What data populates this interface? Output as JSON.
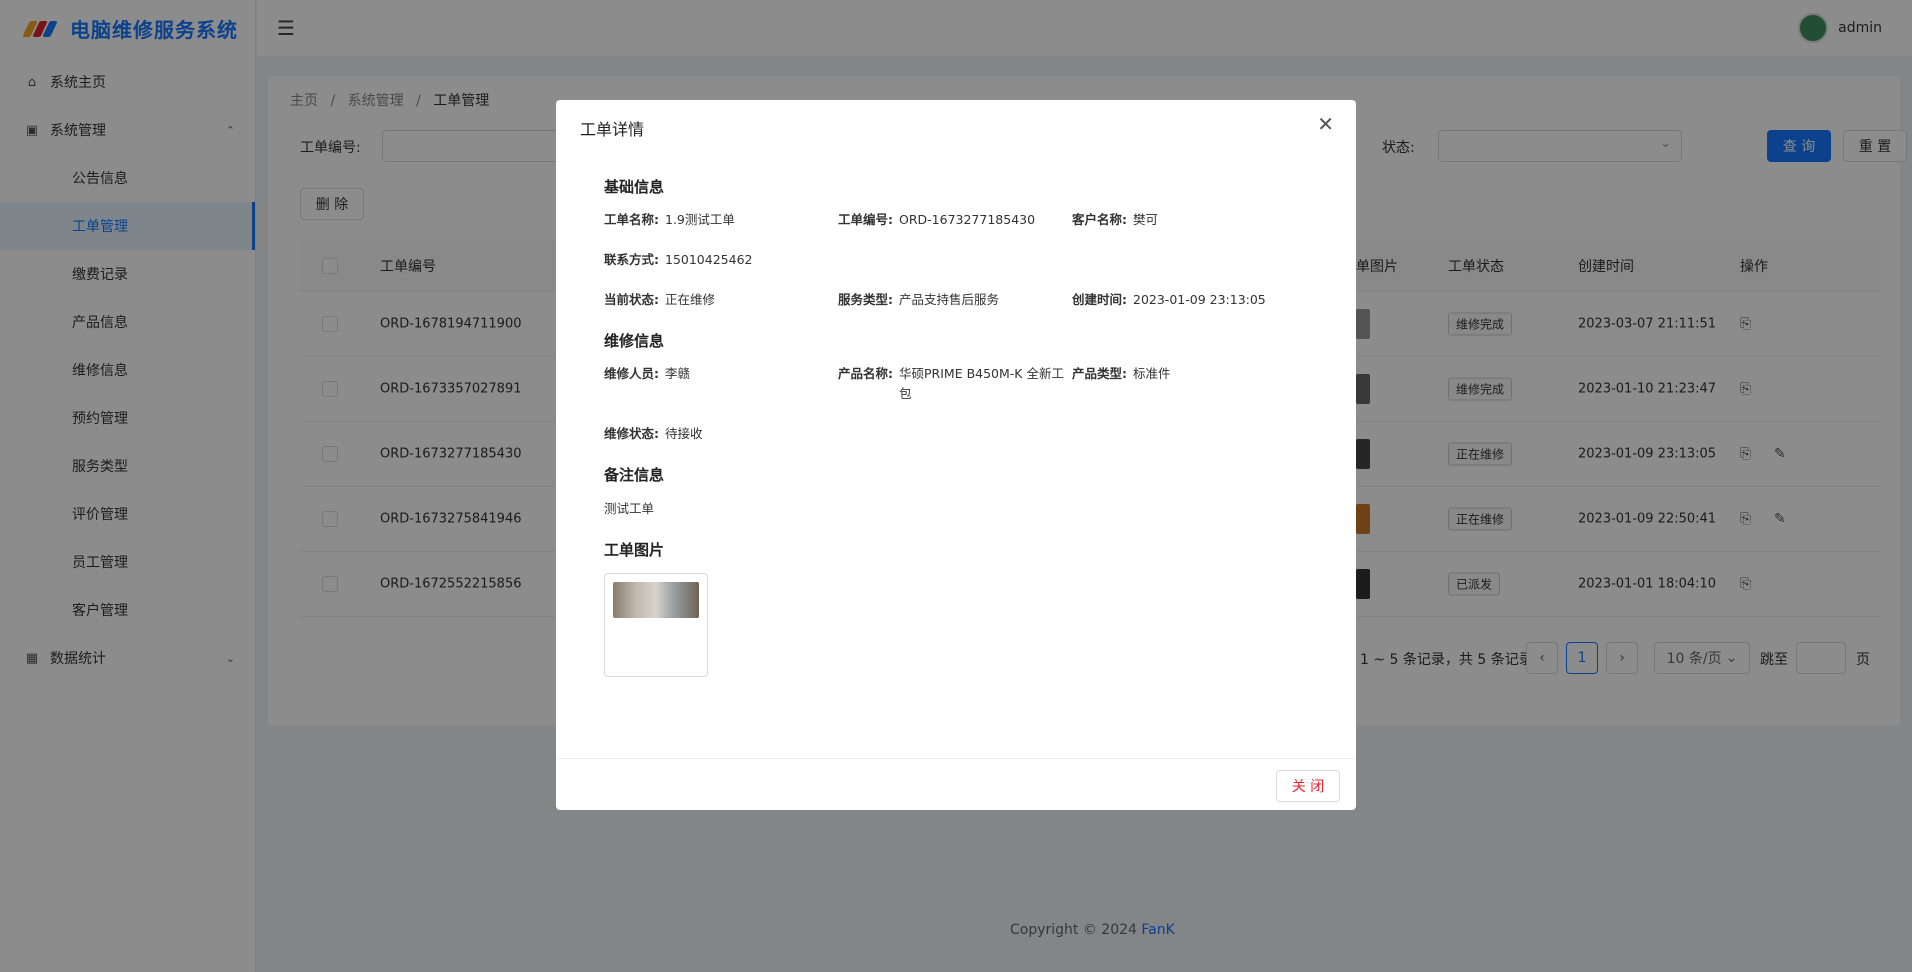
{
  "app": {
    "title": "电脑维修服务系统",
    "user": "admin",
    "brand_color": "#1677ff"
  },
  "sidebar": {
    "items": [
      {
        "label": "系统主页",
        "icon": "home-icon"
      },
      {
        "label": "系统管理",
        "icon": "system-icon"
      },
      {
        "label": "数据统计",
        "icon": "chart-icon"
      }
    ],
    "sub": [
      "公告信息",
      "工单管理",
      "缴费记录",
      "产品信息",
      "维修信息",
      "预约管理",
      "服务类型",
      "评价管理",
      "员工管理",
      "客户管理"
    ]
  },
  "breadcrumb": [
    "主页",
    "系统管理",
    "工单管理"
  ],
  "search": {
    "order_no_label": "工单编号:",
    "status_label": "状态:",
    "query": "查 询",
    "reset": "重 置"
  },
  "toolbar": {
    "delete": "删 除"
  },
  "table": {
    "headers": {
      "order_no": "工单编号",
      "image": "单图片",
      "status": "工单状态",
      "created": "创建时间",
      "ops": "操作"
    },
    "rows": [
      {
        "order_no": "ORD-1678194711900",
        "status": "维修完成",
        "created": "2023-03-07 21:11:51"
      },
      {
        "order_no": "ORD-1673357027891",
        "status": "维修完成",
        "created": "2023-01-10 21:23:47"
      },
      {
        "order_no": "ORD-1673277185430",
        "status": "正在维修",
        "created": "2023-01-09 23:13:05"
      },
      {
        "order_no": "ORD-1673275841946",
        "status": "正在维修",
        "created": "2023-01-09 22:50:41"
      },
      {
        "order_no": "ORD-1672552215856",
        "status": "已派发",
        "created": "2023-01-01 18:04:10"
      }
    ]
  },
  "pagination": {
    "summary": "1 ~ 5 条记录，共 5 条记录",
    "current": "1",
    "page_size": "10 条/页",
    "jump_label": "跳至",
    "page_unit": "页"
  },
  "footer": {
    "copyright": "Copyright © 2024",
    "brand": "FanK"
  },
  "modal": {
    "title": "工单详情",
    "close_label": "关 闭",
    "basic": {
      "title": "基础信息",
      "name_k": "工单名称:",
      "name_v": "1.9测试工单",
      "no_k": "工单编号:",
      "no_v": "ORD-1673277185430",
      "cust_k": "客户名称:",
      "cust_v": "樊可",
      "phone_k": "联系方式:",
      "phone_v": "15010425462",
      "state_k": "当前状态:",
      "state_v": "正在维修",
      "svc_k": "服务类型:",
      "svc_v": "产品支持售后服务",
      "time_k": "创建时间:",
      "time_v": "2023-01-09 23:13:05"
    },
    "repair": {
      "title": "维修信息",
      "staff_k": "维修人员:",
      "staff_v": "李赣",
      "prod_k": "产品名称:",
      "prod_v": "华硕PRIME B450M-K 全新工包",
      "ptype_k": "产品类型:",
      "ptype_v": "标准件",
      "rstate_k": "维修状态:",
      "rstate_v": "待接收"
    },
    "remark": {
      "title": "备注信息",
      "text": "测试工单"
    },
    "images": {
      "title": "工单图片"
    }
  }
}
